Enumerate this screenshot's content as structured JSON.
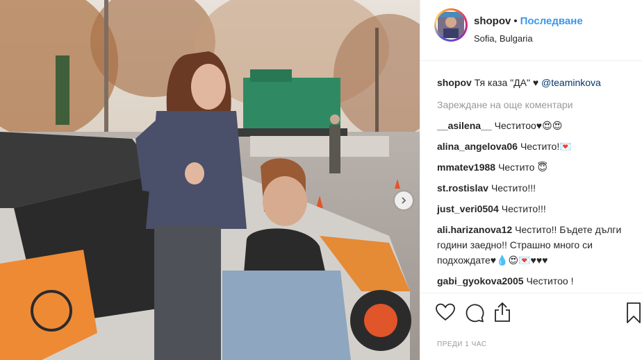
{
  "post": {
    "username": "shopov",
    "follow_label": "Последване",
    "separator": "•",
    "location": "Sofia, Bulgaria"
  },
  "caption": {
    "user": "shopov",
    "text": "Тя каза \"ДА\" ♥",
    "mention": "@teaminkova"
  },
  "load_more_label": "Зареждане на още коментари",
  "comments": [
    {
      "user": "__asilena__",
      "text": "Честитоо♥😍😍"
    },
    {
      "user": "alina_angelova06",
      "text": "Честито!💌"
    },
    {
      "user": "mmatev1988",
      "text": "Честито 😇"
    },
    {
      "user": "st.rostislav",
      "text": "Честито!!!"
    },
    {
      "user": "just_veri0504",
      "text": "Честито!!!"
    },
    {
      "user": "ali.harizanova12",
      "text": "Честито!! Бъдете дълги години заедно!! Страшно много си подхождате♥💧😍💌♥♥♥"
    },
    {
      "user": "gabi_gyokova2005",
      "text": "Честитоо !"
    }
  ],
  "timestamp": "ПРЕДИ 1 ЧАС",
  "icons": {
    "like": "heart-icon",
    "comment": "comment-icon",
    "share": "share-icon",
    "save": "bookmark-icon",
    "next": "chevron-right-icon"
  },
  "colors": {
    "link_blue": "#3897f0",
    "mention_blue": "#003569",
    "muted_gray": "#999999"
  }
}
